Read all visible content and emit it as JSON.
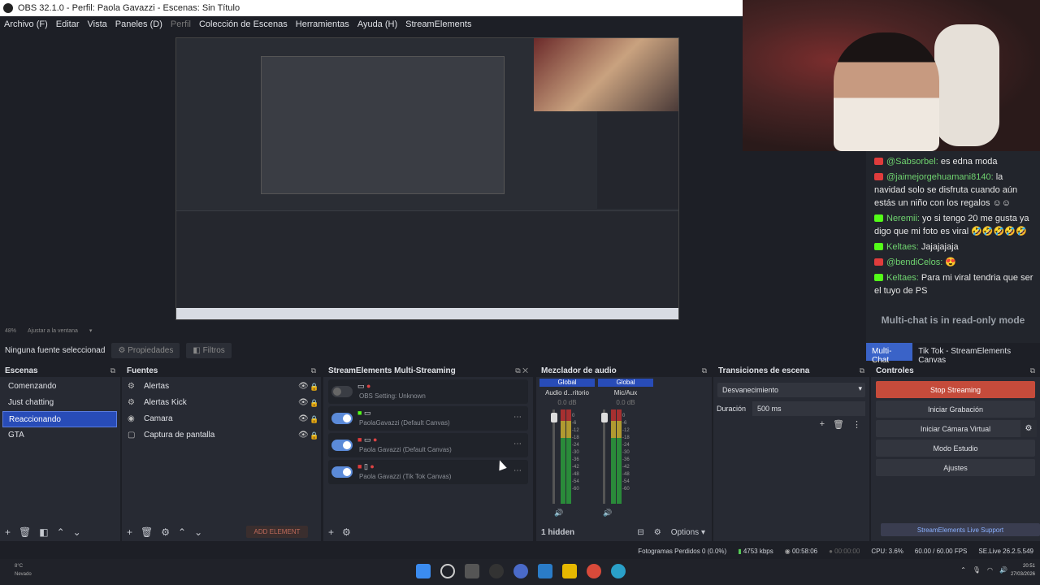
{
  "window": {
    "title": "OBS 32.1.0 - Perfil: Paola Gavazzi - Escenas: Sin Título"
  },
  "menu": [
    {
      "label": "Archivo (F)",
      "dim": false
    },
    {
      "label": "Editar",
      "dim": false
    },
    {
      "label": "Vista",
      "dim": false
    },
    {
      "label": "Paneles (D)",
      "dim": false
    },
    {
      "label": "Perfil",
      "dim": true
    },
    {
      "label": "Colección de Escenas",
      "dim": false
    },
    {
      "label": "Herramientas",
      "dim": false
    },
    {
      "label": "Ayuda (H)",
      "dim": false
    },
    {
      "label": "StreamElements",
      "dim": false
    }
  ],
  "zoombar": {
    "zoom": "48%",
    "fit": "Ajustar a la ventana"
  },
  "propbar": {
    "source_status": "Ninguna fuente seleccionad",
    "properties": "Propiedades",
    "filters": "Filtros"
  },
  "chat": {
    "messages": [
      {
        "platform": "yt",
        "user": "@Sabsorbel:",
        "text": "es edna moda"
      },
      {
        "platform": "yt",
        "user": "@jaimejorgehuamani8140:",
        "text": "la navidad solo se disfruta cuando aún estás un niño con los regalos ☺☺"
      },
      {
        "platform": "kick",
        "user": "Neremii:",
        "text": "yo si tengo 20 me gusta ya digo que mi foto es viral 🤣🤣🤣🤣🤣"
      },
      {
        "platform": "kick",
        "user": "Keltaes:",
        "text": "Jajajajaja"
      },
      {
        "platform": "yt",
        "user": "@bendiCelos:",
        "text": "😍"
      },
      {
        "platform": "kick",
        "user": "Keltaes:",
        "text": "Para mi viral tendria que ser el tuyo de PS"
      }
    ],
    "readonly": "Multi-chat is in read-only mode",
    "tabs": [
      {
        "label": "Multi-Chat",
        "active": true
      },
      {
        "label": "Tik Tok - StreamElements Canvas",
        "active": false
      }
    ]
  },
  "scenes": {
    "title": "Escenas",
    "items": [
      {
        "label": "Comenzando",
        "selected": false
      },
      {
        "label": "Just chatting",
        "selected": false
      },
      {
        "label": "Reaccionando",
        "selected": true
      },
      {
        "label": "GTA",
        "selected": false
      }
    ]
  },
  "sources": {
    "title": "Fuentes",
    "items": [
      {
        "icon": "⚙",
        "label": "Alertas"
      },
      {
        "icon": "⚙",
        "label": "Alertas Kick"
      },
      {
        "icon": "◉",
        "label": "Camara"
      },
      {
        "icon": "▢",
        "label": "Captura de pantalla"
      }
    ],
    "add_element": "ADD ELEMENT"
  },
  "multistream": {
    "title": "StreamElements Multi-Streaming",
    "rows": [
      {
        "on": false,
        "label": "OBS Setting: Unknown"
      },
      {
        "on": true,
        "label": "PaolaGavazzi (Default Canvas)"
      },
      {
        "on": true,
        "label": "Paola Gavazzi (Default Canvas)"
      },
      {
        "on": true,
        "label": "Paola Gavazzi (Tik Tok Canvas)"
      }
    ]
  },
  "mixer": {
    "title": "Mezclador de audio",
    "channels": [
      {
        "global": "Global",
        "name": "Audio d...ritorio",
        "db": "0.0 dB"
      },
      {
        "global": "Global",
        "name": "Mic/Aux",
        "db": "0.0 dB"
      }
    ],
    "scale": [
      "0",
      "-6",
      "-12",
      "-18",
      "-24",
      "-30",
      "-36",
      "-42",
      "-48",
      "-54",
      "-60"
    ],
    "hidden": "1 hidden",
    "options": "Options"
  },
  "transitions": {
    "title": "Transiciones de escena",
    "selected": "Desvanecimiento",
    "duration_label": "Duración",
    "duration": "500 ms"
  },
  "controls": {
    "title": "Controles",
    "stop": "Stop Streaming",
    "record": "Iniciar Grabación",
    "vcam": "Iniciar Cámara Virtual",
    "studio": "Modo Estudio",
    "settings": "Ajustes",
    "live_support": "StreamElements Live Support"
  },
  "status": {
    "dropped": "Fotogramas Perdidos 0 (0.0%)",
    "bitrate": "4753 kbps",
    "stream_time": "00:58:06",
    "rec_time": "00:00:00",
    "cpu": "CPU: 3.6%",
    "fps": "60.00 / 60.00 FPS",
    "se_live": "SE.Live 26.2.5.549"
  },
  "taskbar": {
    "temp": "8°C",
    "weather": "Nevado",
    "time": "20:51",
    "date": "27/03/2026"
  }
}
